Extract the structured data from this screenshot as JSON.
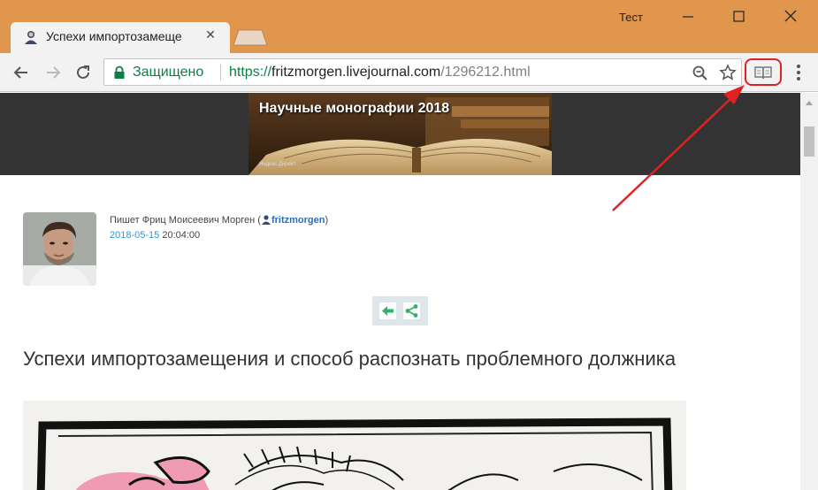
{
  "browser": {
    "tab_title": "Успехи импортозамеще",
    "profile_name": "Тест",
    "secure_label": "Защищено",
    "url_scheme": "https://",
    "url_host": "fritzmorgen.livejournal.com",
    "url_path": "/1296212.html",
    "accent_color": "#e1964d",
    "highlight_color": "#e12020"
  },
  "banner": {
    "title": "Научные монографии 2018",
    "ad_label": "Яндекс.Директ"
  },
  "post": {
    "byline_prefix": "Пишет Фриц Моисеевич Морген (",
    "username": "fritzmorgen",
    "byline_suffix": ")",
    "date": "2018-05-15",
    "time": "20:04:00",
    "title": "Успехи импортозамещения и способ распознать проблемного должника"
  },
  "icons": {
    "tab_favicon": "user-icon",
    "close": "close-icon",
    "back": "back-arrow-icon",
    "forward": "forward-arrow-icon",
    "reload": "reload-icon",
    "lock": "lock-icon",
    "zoom": "zoom-out-icon",
    "bookmark": "star-icon",
    "reader": "reader-mode-book-icon",
    "menu": "kebab-menu-icon",
    "share": "share-icon",
    "prev": "arrow-left-icon"
  }
}
